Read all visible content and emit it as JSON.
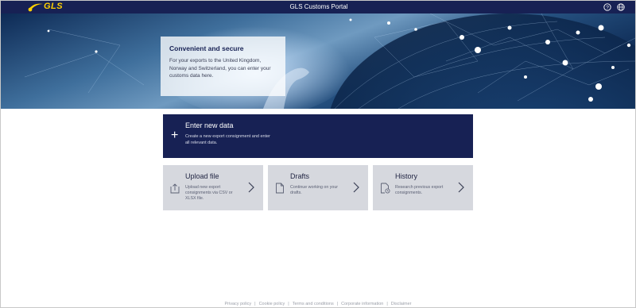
{
  "header": {
    "logo_text": "GLS",
    "title": "GLS Customs Portal",
    "icons": [
      "help-icon",
      "language-globe-icon"
    ],
    "brand_color": "#172154",
    "logo_color": "#ffd100"
  },
  "hero": {
    "title": "Convenient and secure",
    "text": "For your exports to the United Kingdom, Norway and Switzerland, you can enter your customs data here."
  },
  "primary_tile": {
    "title": "Enter new data",
    "description": "Create a new export consignment and enter all relevant data.",
    "icon": "plus-icon"
  },
  "tiles": [
    {
      "title": "Upload file",
      "description": "Upload new export consignments via CSV or XLSX file.",
      "icon": "upload-file-icon"
    },
    {
      "title": "Drafts",
      "description": "Continue working on your drafts.",
      "icon": "document-icon"
    },
    {
      "title": "History",
      "description": "Research previous export consignments.",
      "icon": "history-document-icon"
    }
  ],
  "footer": {
    "links": [
      "Privacy policy",
      "Cookie policy",
      "Terms and conditions",
      "Corporate information",
      "Disclaimer"
    ]
  }
}
